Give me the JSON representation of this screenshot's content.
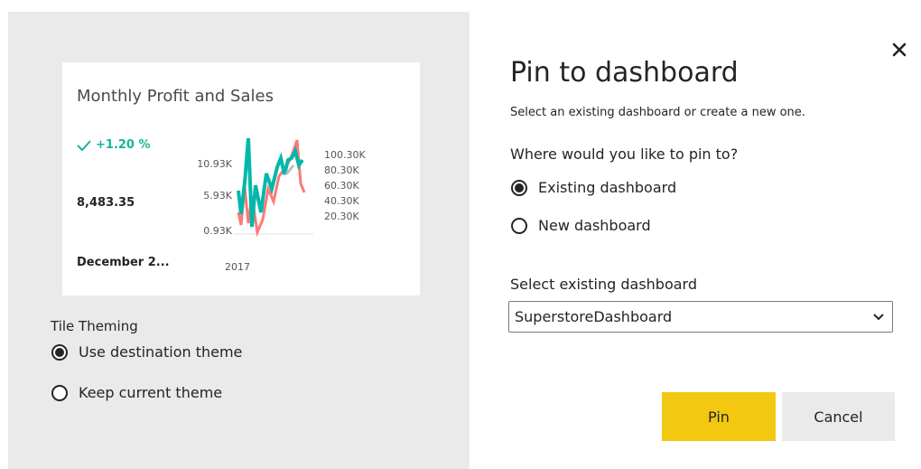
{
  "tile": {
    "title": "Monthly Profit and Sales",
    "kpi_change": "+1.20 %",
    "kpi_value": "8,483.35",
    "kpi_date": "December 2...",
    "left_axis": [
      "10.93K",
      "5.93K",
      "0.93K"
    ],
    "right_axis": [
      "100.30K",
      "80.30K",
      "60.30K",
      "40.30K",
      "20.30K"
    ],
    "x_label": "2017",
    "colors": {
      "profit": "#01b8aa",
      "sales": "#fd625e",
      "change": "#16b39a"
    }
  },
  "theming": {
    "title": "Tile Theming",
    "options": [
      {
        "label": "Use destination theme",
        "selected": true
      },
      {
        "label": "Keep current theme",
        "selected": false
      }
    ]
  },
  "dialog": {
    "title": "Pin to dashboard",
    "subtitle": "Select an existing dashboard or create a new one.",
    "where_label": "Where would you like to pin to?",
    "options": [
      {
        "label": "Existing dashboard",
        "selected": true
      },
      {
        "label": "New dashboard",
        "selected": false
      }
    ],
    "select_label": "Select existing dashboard",
    "select_value": "SuperstoreDashboard",
    "pin_label": "Pin",
    "cancel_label": "Cancel",
    "pin_color": "#f2c811"
  }
}
